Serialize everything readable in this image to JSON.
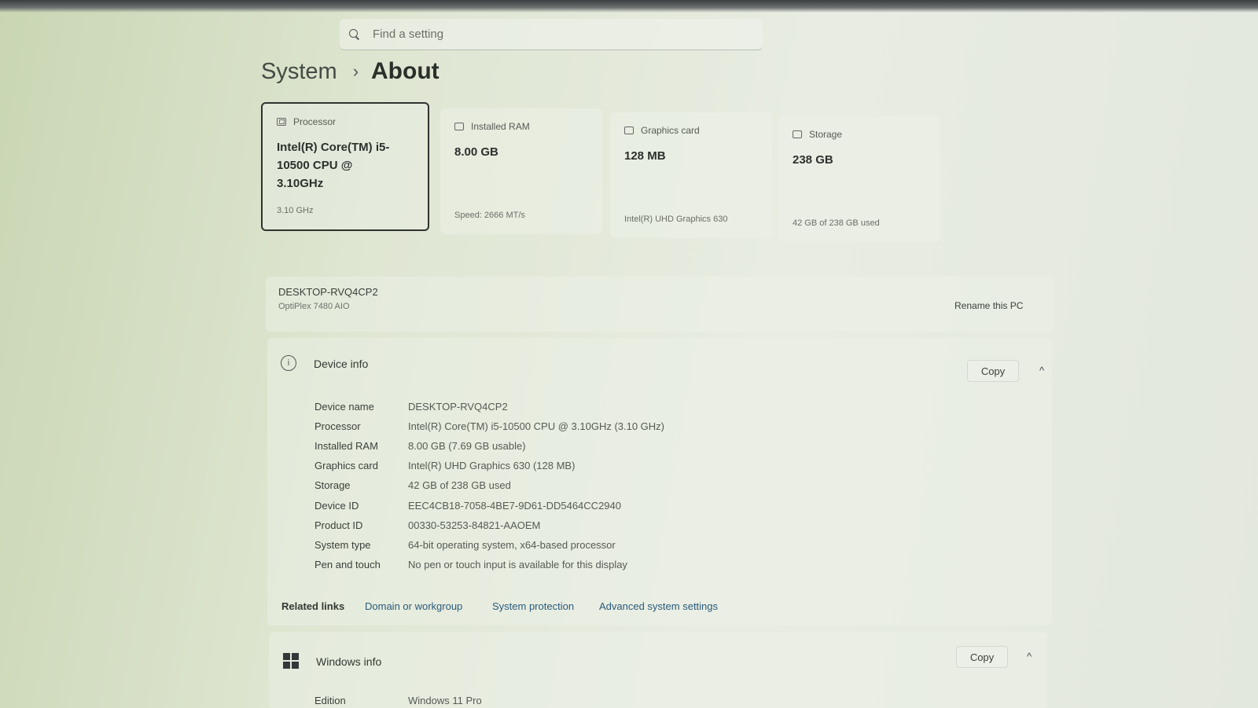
{
  "search": {
    "placeholder": "Find a setting"
  },
  "breadcrumb": {
    "parent": "System",
    "separator": "›",
    "current": "About"
  },
  "specs_cards": [
    {
      "icon": "processor-icon",
      "title": "Processor",
      "value": "Intel(R) Core(TM) i5-10500 CPU @ 3.10GHz",
      "sub": "3.10 GHz"
    },
    {
      "icon": "ram-icon",
      "title": "Installed RAM",
      "value": "8.00 GB",
      "sub": "Speed: 2666 MT/s"
    },
    {
      "icon": "graphics-card-icon",
      "title": "Graphics card",
      "value": "128 MB",
      "sub": "Intel(R) UHD Graphics 630"
    },
    {
      "icon": "storage-icon",
      "title": "Storage",
      "value": "238 GB",
      "sub": "42 GB of 238 GB used"
    }
  ],
  "pc": {
    "name": "DESKTOP-RVQ4CP2",
    "model": "OptiPlex 7480 AIO",
    "rename_label": "Rename this PC"
  },
  "device_info": {
    "title": "Device info",
    "copy_label": "Copy",
    "chevron": "^",
    "rows": [
      {
        "label": "Device name",
        "value": "DESKTOP-RVQ4CP2"
      },
      {
        "label": "Processor",
        "value": "Intel(R) Core(TM) i5-10500 CPU @ 3.10GHz (3.10 GHz)"
      },
      {
        "label": "Installed RAM",
        "value": "8.00 GB (7.69 GB usable)"
      },
      {
        "label": "Graphics card",
        "value": "Intel(R) UHD Graphics 630 (128 MB)"
      },
      {
        "label": "Storage",
        "value": "42 GB of 238 GB used"
      },
      {
        "label": "Device ID",
        "value": "EEC4CB18-7058-4BE7-9D61-DD5464CC2940"
      },
      {
        "label": "Product ID",
        "value": "00330-53253-84821-AAOEM"
      },
      {
        "label": "System type",
        "value": "64-bit operating system, x64-based processor"
      },
      {
        "label": "Pen and touch",
        "value": "No pen or touch input is available for this display"
      }
    ]
  },
  "related_links": {
    "label": "Related links",
    "links": [
      "Domain or workgroup",
      "System protection",
      "Advanced system settings"
    ]
  },
  "windows_info": {
    "title": "Windows info",
    "copy_label": "Copy",
    "chevron": "^",
    "rows": [
      {
        "label": "Edition",
        "value": "Windows 11 Pro"
      }
    ]
  },
  "colors": {
    "background": "#dfe6d2",
    "link": "#2a5a7a",
    "text": "#2a2f2a"
  }
}
